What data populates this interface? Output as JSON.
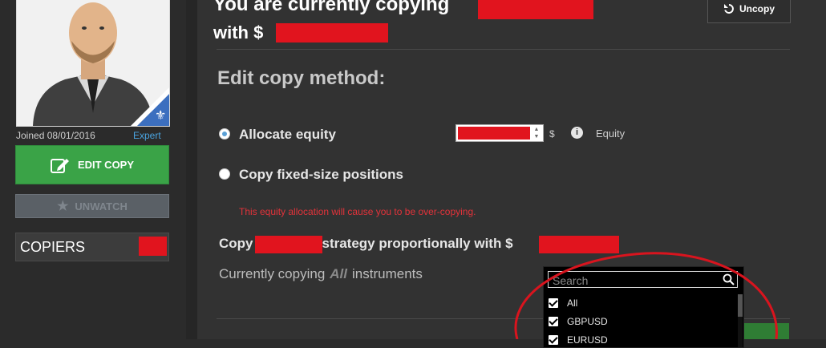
{
  "profile": {
    "joined": "Joined 08/01/2016",
    "level": "Expert",
    "edit_copy_label": "EDIT COPY",
    "unwatch_label": "UNWATCH",
    "copiers_label": "COPIERS"
  },
  "header": {
    "title_line1": "You are currently copying",
    "title_line2": "with $",
    "uncopy_label": "Uncopy"
  },
  "edit": {
    "heading": "Edit copy method:",
    "options": [
      {
        "label": "Allocate equity",
        "selected": true
      },
      {
        "label": "Copy fixed-size positions",
        "selected": false
      }
    ],
    "currency": "$",
    "info_glyph": "i",
    "equity_label": "Equity",
    "warning": "This equity allocation will cause you to be over-copying.",
    "copy_prefix": "Copy",
    "copy_middle": "strategy proportionally with $",
    "currently_prefix": "Currently copying",
    "currently_value": "All",
    "currently_suffix": "instruments"
  },
  "dropdown": {
    "search_placeholder": "Search",
    "items": [
      {
        "label": "All",
        "checked": true
      },
      {
        "label": "GBPUSD",
        "checked": true
      },
      {
        "label": "EURUSD",
        "checked": true
      }
    ]
  },
  "colors": {
    "accent_green": "#3aa347",
    "redaction": "#e1141e",
    "annotation_red": "#d9141e",
    "link_blue": "#4aa3df"
  }
}
